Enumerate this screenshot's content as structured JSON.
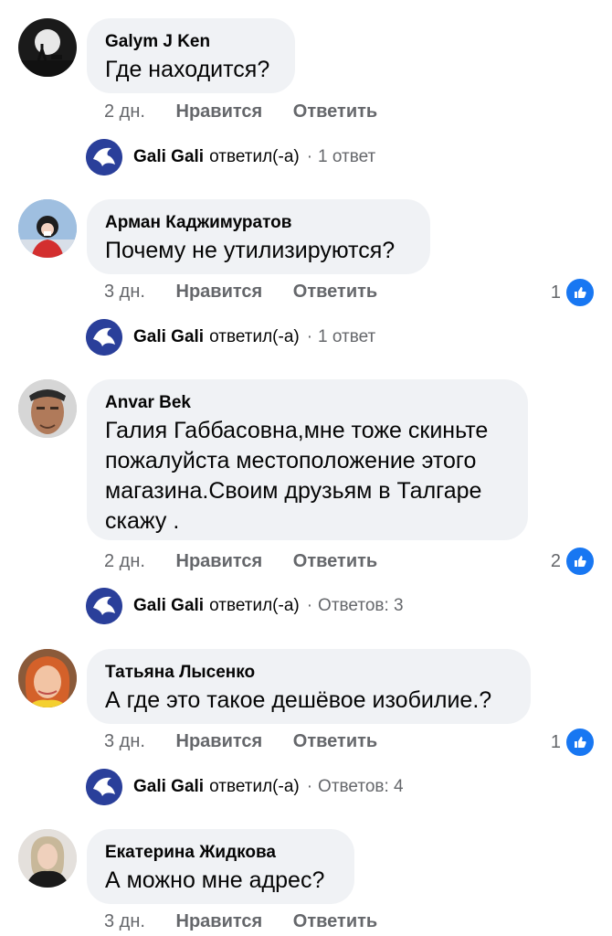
{
  "actions": {
    "like": "Нравится",
    "reply": "Ответить"
  },
  "reply_verb": "ответил(-а)",
  "reply_dot": "·",
  "comments": [
    {
      "author": "Galym J Ken",
      "text": "Где находится?",
      "time": "2 дн.",
      "likes": "",
      "reply": {
        "name": "Gali Gali",
        "count": "1 ответ"
      }
    },
    {
      "author": "Арман Каджимуратов",
      "text": "Почему не утилизируются?",
      "time": "3 дн.",
      "likes": "1",
      "reply": {
        "name": "Gali Gali",
        "count": "1 ответ"
      }
    },
    {
      "author": "Anvar Bek",
      "text": "Галия Габбасовна,мне тоже скиньте пожалуйста местоположение этого магазина.Своим друзьям в Талгаре скажу .",
      "time": "2 дн.",
      "likes": "2",
      "reply": {
        "name": "Gali Gali",
        "count": "Ответов: 3"
      }
    },
    {
      "author": "Татьяна Лысенко",
      "text": "А где это такое дешёвое изобилие.?",
      "time": "3 дн.",
      "likes": "1",
      "reply": {
        "name": "Gali Gali",
        "count": "Ответов: 4"
      }
    },
    {
      "author": "Екатерина Жидкова",
      "text": "А можно мне адрес?",
      "time": "3 дн.",
      "likes": ""
    }
  ],
  "colors": {
    "bubble": "#f0f2f5",
    "meta": "#65676b",
    "like": "#1877f2"
  }
}
